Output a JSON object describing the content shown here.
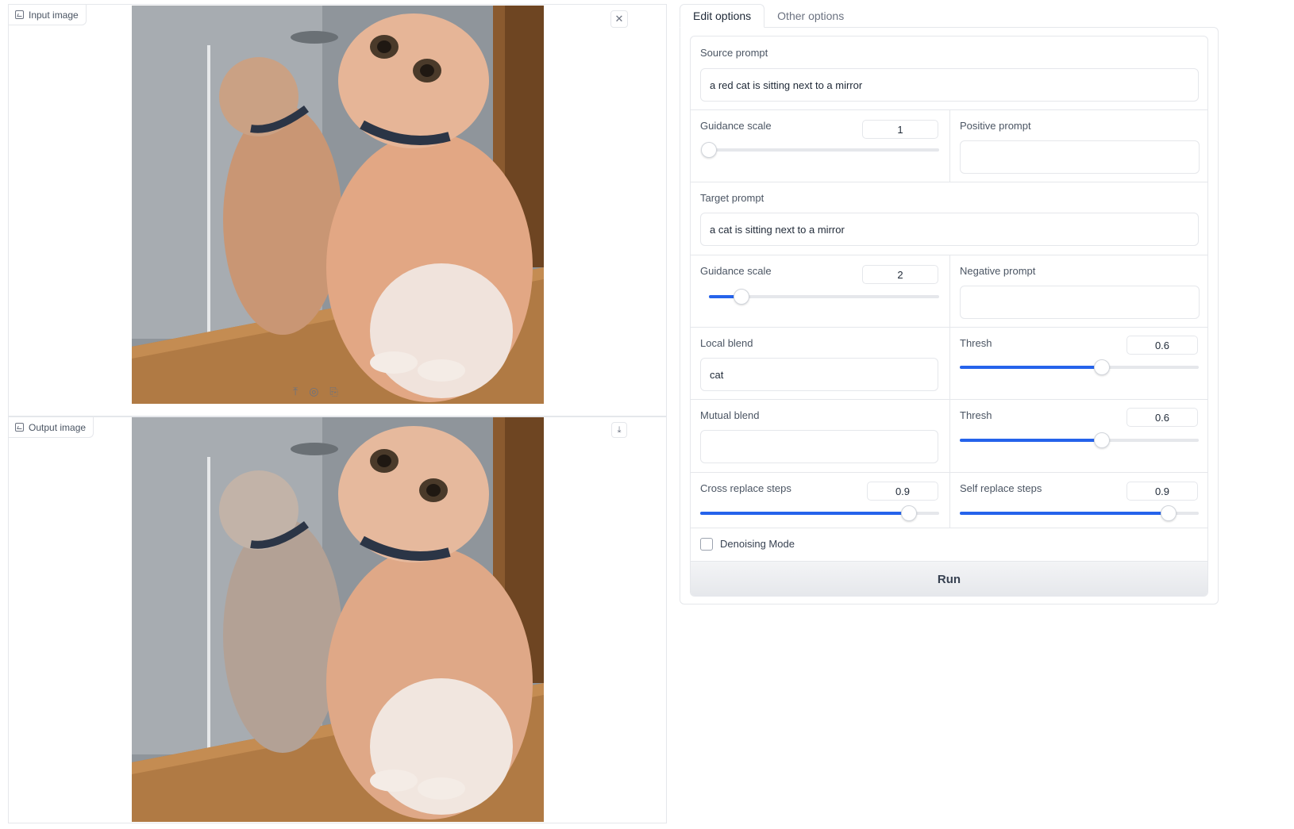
{
  "input_panel": {
    "label": "Input image",
    "close_icon": "close-icon",
    "tools": [
      "upload-icon",
      "camera-icon",
      "clipboard-icon"
    ]
  },
  "output_panel": {
    "label": "Output image",
    "download_icon": "download-icon"
  },
  "tabs": [
    {
      "label": "Edit options",
      "active": true
    },
    {
      "label": "Other options",
      "active": false
    }
  ],
  "form": {
    "source_prompt": {
      "label": "Source prompt",
      "value": "a red cat is sitting next to a mirror"
    },
    "source_guidance": {
      "label": "Guidance scale",
      "value": "1",
      "fraction": 0.0
    },
    "positive_prompt": {
      "label": "Positive prompt",
      "value": ""
    },
    "target_prompt": {
      "label": "Target prompt",
      "value": "a cat is sitting next to a mirror"
    },
    "target_guidance": {
      "label": "Guidance scale",
      "value": "2",
      "fraction": 0.14
    },
    "negative_prompt": {
      "label": "Negative prompt",
      "value": ""
    },
    "local_blend": {
      "label": "Local blend",
      "value": "cat"
    },
    "local_thresh": {
      "label": "Thresh",
      "value": "0.6",
      "fraction": 0.595
    },
    "mutual_blend": {
      "label": "Mutual blend",
      "value": ""
    },
    "mutual_thresh": {
      "label": "Thresh",
      "value": "0.6",
      "fraction": 0.595
    },
    "cross_replace": {
      "label": "Cross replace steps",
      "value": "0.9",
      "fraction": 0.875
    },
    "self_replace": {
      "label": "Self replace steps",
      "value": "0.9",
      "fraction": 0.875
    },
    "denoising": {
      "label": "Denoising Mode",
      "checked": false
    },
    "run_label": "Run"
  },
  "colors": {
    "accent": "#2563eb",
    "border": "#e5e7eb"
  }
}
